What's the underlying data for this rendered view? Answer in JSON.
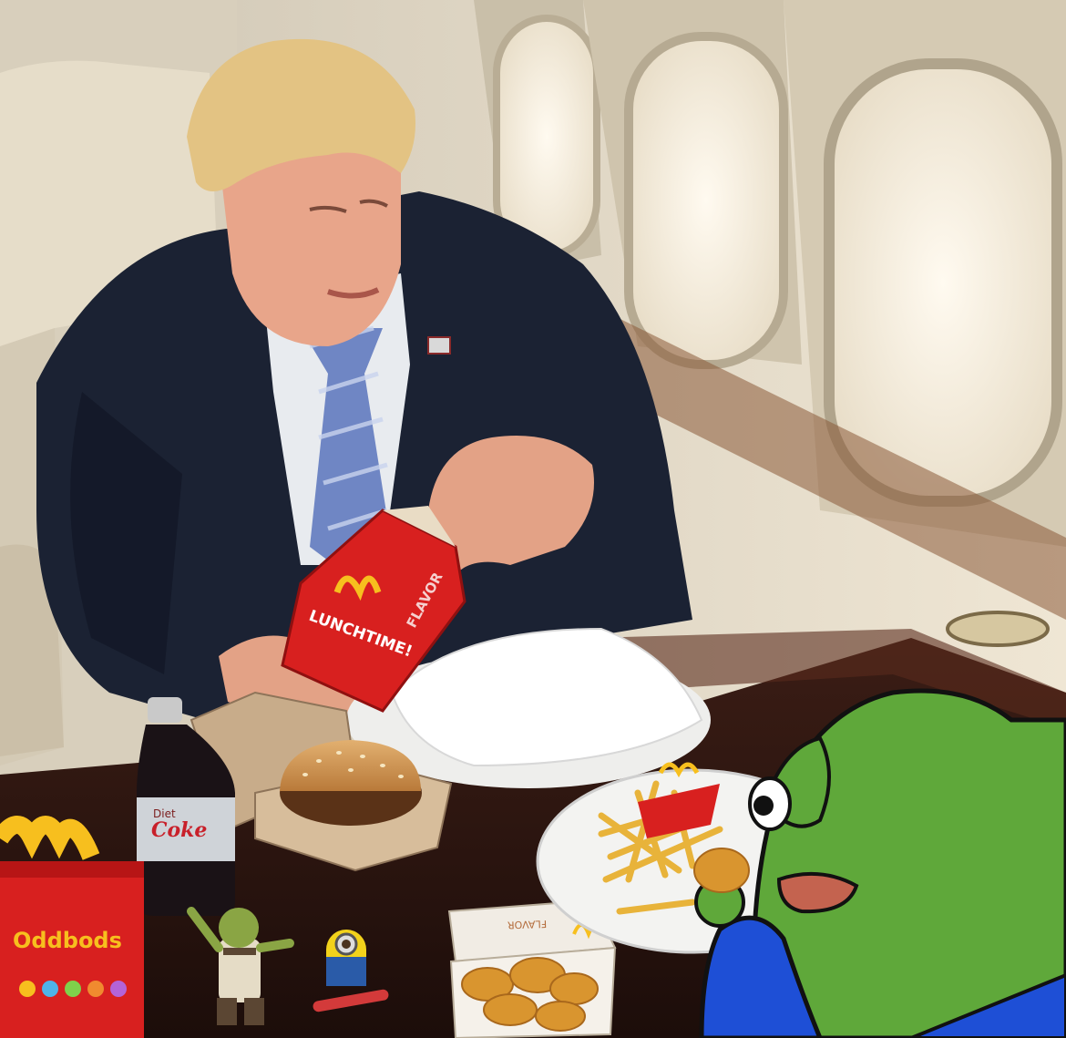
{
  "photo": {
    "bag_text": "LUNCHTIME!",
    "bag_side_text": "FLAVOR",
    "bottle_text": "Coke",
    "bottle_subtext": "Diet",
    "happy_meal_text": "Oddbods",
    "nugget_box_text": "FLAVOR",
    "colors": {
      "cabin_wall": "#e9e0cf",
      "window_light": "#f6efe2",
      "suit": "#1b2233",
      "table_wood": "#2a1410",
      "mcdonalds_red": "#d8201f",
      "arches_yellow": "#f7bf1e",
      "frog_green": "#5fa83a",
      "frog_lip": "#c4634f",
      "frog_shirt": "#1e4fd6"
    }
  }
}
